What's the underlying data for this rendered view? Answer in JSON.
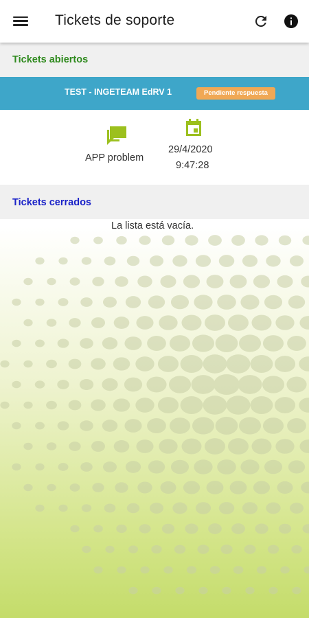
{
  "app_bar": {
    "title": "Tickets de soporte",
    "icons": [
      "menu-icon",
      "refresh-icon",
      "info-icon"
    ]
  },
  "open_section": {
    "title": "Tickets abiertos",
    "tickets": [
      {
        "name": "TEST - INGETEAM EdRV 1",
        "status": "Pendiente respuesta",
        "subject": "APP problem",
        "date": "29/4/2020",
        "time": "9:47:28"
      }
    ]
  },
  "closed_section": {
    "title": "Tickets cerrados",
    "empty_message": "La lista está vacía."
  },
  "colors": {
    "open_title": "#2f8a1e",
    "closed_title": "#1a22c8",
    "ticket_header": "#3ea6c9",
    "status_badge": "#f0a855",
    "icon_green": "#9cc01e"
  }
}
